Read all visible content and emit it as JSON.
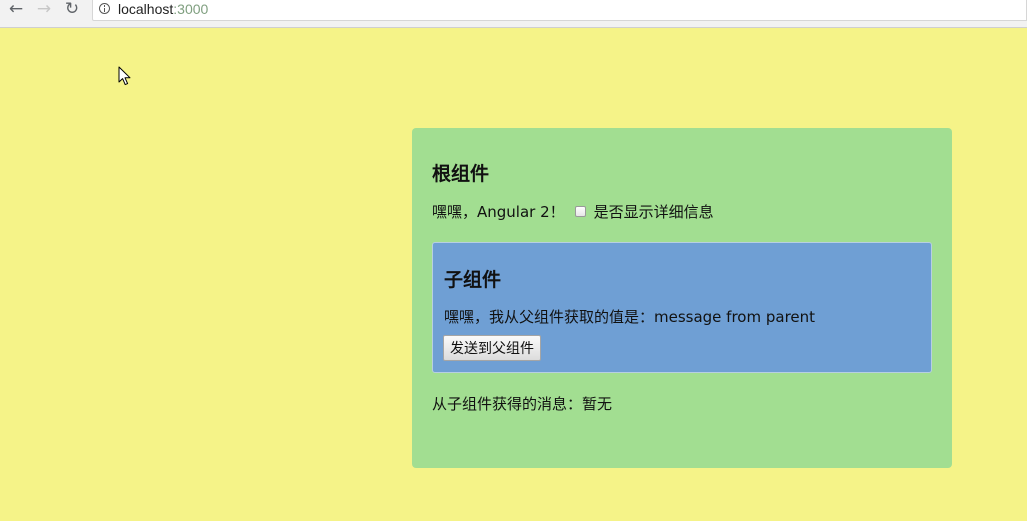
{
  "browser": {
    "url_host": "localhost",
    "url_port": ":3000"
  },
  "root": {
    "title": "根组件",
    "greeting": "嘿嘿，Angular 2！",
    "checkbox_label": "是否显示详细信息",
    "checkbox_checked": false,
    "parent_message": "从子组件获得的消息：暂无"
  },
  "child": {
    "title": "子组件",
    "text": "嘿嘿，我从父组件获取的值是：message from parent",
    "button_label": "发送到父组件"
  },
  "colors": {
    "page_background": "#f5f388",
    "root_panel": "#a2de91",
    "child_panel": "#6f9fd4"
  },
  "icons": {
    "back": "arrow-left-icon",
    "forward": "arrow-right-icon",
    "reload": "reload-icon",
    "site_info": "info-icon"
  }
}
